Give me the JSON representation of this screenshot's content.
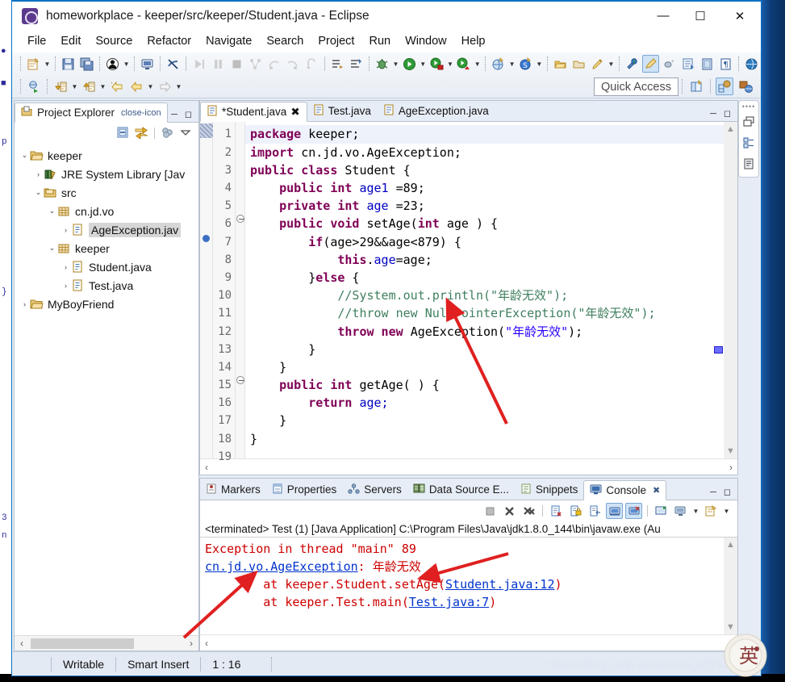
{
  "window": {
    "title": "homeworkplace - keeper/src/keeper/Student.java - Eclipse",
    "app_icon": "eclipse-icon",
    "minimize": "—",
    "maximize": "☐",
    "close": "✕"
  },
  "menu": {
    "items": [
      "File",
      "Edit",
      "Source",
      "Refactor",
      "Navigate",
      "Search",
      "Project",
      "Run",
      "Window",
      "Help"
    ]
  },
  "toolbar": {
    "quick_access_placeholder": "Quick Access",
    "row1_icons": [
      "new-wizard-icon",
      "save-icon",
      "save-all-icon",
      "print-icon",
      "toggle-mark-occurrences-icon",
      "skip-breakpoints-icon",
      "resume-icon",
      "suspend-icon",
      "terminate-icon",
      "step-into-icon",
      "step-over-icon",
      "step-return-icon",
      "drop-to-frame-icon",
      "next-annotation-icon",
      "previous-annotation-icon",
      "debug-icon",
      "run-icon",
      "run-as-server-icon",
      "profile-icon",
      "new-java-project-icon",
      "new-class-icon",
      "open-type-icon",
      "open-task-icon",
      "search-icon",
      "external-tools-icon",
      "pin-editor-icon",
      "toggle-block-selection-icon",
      "show-whitespace-icon",
      "open-web-browser-icon"
    ],
    "row2_icons": [
      "open-declaration-icon",
      "next-edit-icon",
      "previous-edit-icon",
      "back-icon",
      "forward-icon"
    ],
    "perspective_icons": [
      "open-perspective-icon",
      "java-perspective-icon",
      "java-ee-perspective-icon"
    ]
  },
  "project_explorer": {
    "tab_label": "Project Explorer",
    "tab_icon": "project-explorer-icon",
    "close_icon": "close-icon",
    "minimize_icon": "minimize-icon",
    "maximize_icon": "maximize-icon",
    "toolbar_icons": [
      "collapse-all-icon",
      "link-with-editor-icon",
      "view-menu-icon",
      "view-dropdown-icon"
    ],
    "tree": [
      {
        "label": "keeper",
        "indent": 0,
        "twisty": "⌄",
        "icon": "java-project-icon",
        "selected": false
      },
      {
        "label": "JRE System Library [Jav",
        "indent": 1,
        "twisty": "›",
        "icon": "jre-library-icon",
        "selected": false
      },
      {
        "label": "src",
        "indent": 1,
        "twisty": "⌄",
        "icon": "source-folder-icon",
        "selected": false
      },
      {
        "label": "cn.jd.vo",
        "indent": 2,
        "twisty": "⌄",
        "icon": "package-icon",
        "selected": false
      },
      {
        "label": "AgeException.jav",
        "indent": 3,
        "twisty": "›",
        "icon": "java-file-icon",
        "selected": true
      },
      {
        "label": "keeper",
        "indent": 2,
        "twisty": "⌄",
        "icon": "package-icon",
        "selected": false
      },
      {
        "label": "Student.java",
        "indent": 3,
        "twisty": "›",
        "icon": "java-file-icon",
        "selected": false
      },
      {
        "label": "Test.java",
        "indent": 3,
        "twisty": "›",
        "icon": "java-file-icon",
        "selected": false
      },
      {
        "label": "MyBoyFriend",
        "indent": 0,
        "twisty": "›",
        "icon": "java-project-icon",
        "selected": false
      }
    ]
  },
  "editor": {
    "tabs": [
      {
        "label": "*Student.java",
        "icon": "java-file-icon",
        "active": true,
        "closable": true
      },
      {
        "label": "Test.java",
        "icon": "java-file-icon",
        "active": false,
        "closable": false
      },
      {
        "label": "AgeException.java",
        "icon": "java-file-icon",
        "active": false,
        "closable": false
      }
    ],
    "minimize_icon": "minimize-icon",
    "maximize_icon": "maximize-icon",
    "line_numbers": [
      "1",
      "2",
      "3",
      "4",
      "5",
      "6",
      "7",
      "8",
      "9",
      "10",
      "11",
      "12",
      "13",
      "14",
      "15",
      "16",
      "17",
      "18",
      "19"
    ],
    "code_lines": [
      [
        {
          "t": "package ",
          "c": "kw"
        },
        {
          "t": "keeper;",
          "c": "typ"
        }
      ],
      [
        {
          "t": "import ",
          "c": "kw"
        },
        {
          "t": "cn.jd.vo.AgeException;",
          "c": "typ"
        }
      ],
      [
        {
          "t": "public class ",
          "c": "kw"
        },
        {
          "t": "Student {",
          "c": "typ"
        }
      ],
      [
        {
          "t": "    public int ",
          "c": "kw"
        },
        {
          "t": "age1 ",
          "c": "fld"
        },
        {
          "t": "=89;",
          "c": "typ"
        }
      ],
      [
        {
          "t": "    private int ",
          "c": "kw"
        },
        {
          "t": "age ",
          "c": "fld"
        },
        {
          "t": "=23;",
          "c": "typ"
        }
      ],
      [
        {
          "t": "    public void ",
          "c": "kw"
        },
        {
          "t": "setAge(",
          "c": "typ"
        },
        {
          "t": "int ",
          "c": "kw"
        },
        {
          "t": "age ) {",
          "c": "typ"
        }
      ],
      [
        {
          "t": "        if",
          "c": "kw"
        },
        {
          "t": "(age>29&&age<879) {",
          "c": "typ"
        }
      ],
      [
        {
          "t": "            this",
          "c": "kw"
        },
        {
          "t": ".",
          "c": "typ"
        },
        {
          "t": "age",
          "c": "fld"
        },
        {
          "t": "=age;",
          "c": "typ"
        }
      ],
      [
        {
          "t": "        }",
          "c": "typ"
        },
        {
          "t": "else",
          "c": "kw"
        },
        {
          "t": " {",
          "c": "typ"
        }
      ],
      [
        {
          "t": "            //System.out.println(\"年龄无效\");",
          "c": "cmt"
        }
      ],
      [
        {
          "t": "            //throw new NullPointerException(\"年龄无效\");",
          "c": "cmt"
        }
      ],
      [
        {
          "t": "            throw new ",
          "c": "kw"
        },
        {
          "t": "AgeException(",
          "c": "typ"
        },
        {
          "t": "\"年龄无效\"",
          "c": "str"
        },
        {
          "t": ");",
          "c": "typ"
        }
      ],
      [
        {
          "t": "        }",
          "c": "typ"
        }
      ],
      [
        {
          "t": "    }",
          "c": "typ"
        }
      ],
      [
        {
          "t": "    public int ",
          "c": "kw"
        },
        {
          "t": "getAge( ) {",
          "c": "typ"
        }
      ],
      [
        {
          "t": "        return ",
          "c": "kw"
        },
        {
          "t": "age;",
          "c": "fld"
        }
      ],
      [
        {
          "t": "    }",
          "c": "typ"
        }
      ],
      [
        {
          "t": "}",
          "c": "typ"
        }
      ],
      [
        {
          "t": "",
          "c": "typ"
        }
      ]
    ],
    "folded_lines": [
      6,
      15
    ],
    "breakpoint_line": 7,
    "current_line": 1
  },
  "console": {
    "tabs": [
      {
        "label": "Markers",
        "icon": "markers-icon",
        "active": false
      },
      {
        "label": "Properties",
        "icon": "properties-icon",
        "active": false
      },
      {
        "label": "Servers",
        "icon": "servers-icon",
        "active": false
      },
      {
        "label": "Data Source E...",
        "icon": "data-source-explorer-icon",
        "active": false
      },
      {
        "label": "Snippets",
        "icon": "snippets-icon",
        "active": false
      },
      {
        "label": "Console",
        "icon": "console-icon",
        "active": true
      }
    ],
    "close_icon": "close-icon",
    "minimize_icon": "minimize-icon",
    "maximize_icon": "maximize-icon",
    "toolbar_icons": [
      "terminate-icon",
      "remove-launch-icon",
      "remove-all-terminated-icon",
      "clear-console-icon",
      "scroll-lock-icon",
      "word-wrap-icon",
      "show-console-on-output-icon",
      "show-console-on-error-icon",
      "pin-console-icon",
      "display-selected-console-icon",
      "display-selected-console-dropdown-icon",
      "open-console-icon",
      "open-console-dropdown-icon"
    ],
    "header": "<terminated> Test (1) [Java Application] C:\\Program Files\\Java\\jdk1.8.0_144\\bin\\javaw.exe (Au",
    "output": [
      [
        {
          "t": "Exception in thread \"main\" 89",
          "c": "cnorm"
        }
      ],
      [
        {
          "t": "cn.jd.vo.AgeException",
          "c": "clink"
        },
        {
          "t": ": 年龄无效",
          "c": "cnorm"
        }
      ],
      [
        {
          "t": "\tat keeper.Student.setAge(",
          "c": "cnorm"
        },
        {
          "t": "Student.java:12",
          "c": "clink"
        },
        {
          "t": ")",
          "c": "cnorm"
        }
      ],
      [
        {
          "t": "\tat keeper.Test.main(",
          "c": "cnorm"
        },
        {
          "t": "Test.java:7",
          "c": "clink"
        },
        {
          "t": ")",
          "c": "cnorm"
        }
      ]
    ]
  },
  "fast_view": {
    "icons": [
      "restore-icon",
      "outline-icon",
      "task-list-icon"
    ]
  },
  "status_bar": {
    "writable": "Writable",
    "insert_mode": "Smart Insert",
    "cursor_position": "1 : 16",
    "watermark": "https://blog.csdn.net/weixin_42784914"
  },
  "ime": {
    "label": "英"
  },
  "colors": {
    "title_bar": "#ffffff",
    "accent_border": "#0b72c4",
    "keyword": "#7f0055",
    "string": "#2a00ff",
    "comment": "#3f7f5f",
    "field": "#0000c0",
    "console_error": "#cc0000",
    "console_link": "#0033cc",
    "selection": "#d6d6d6",
    "annotation_arrow": "#e02020"
  }
}
